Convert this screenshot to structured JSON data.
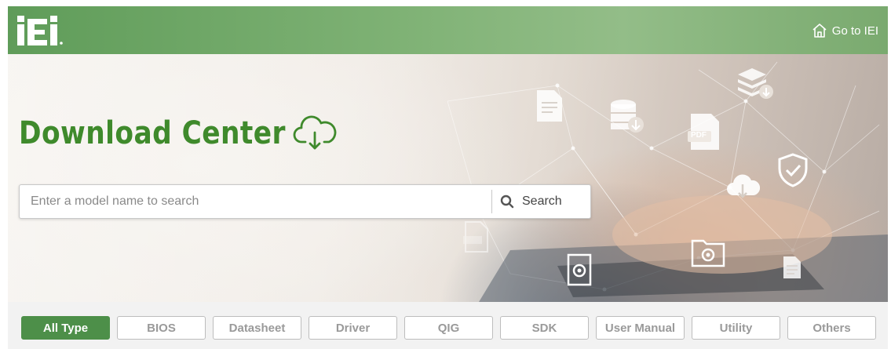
{
  "header": {
    "logo_text": "iEi",
    "goto_label": "Go to IEI",
    "home_icon": "home-icon"
  },
  "hero": {
    "title": "Download Center",
    "title_color": "#3f8a2c",
    "title_icon": "cloud-download-icon",
    "search": {
      "placeholder": "Enter a model name to search",
      "value": "",
      "button_label": "Search",
      "button_icon": "search-icon"
    },
    "decor_icons": [
      "document-icon",
      "database-download-icon",
      "stack-download-icon",
      "pdf-file-icon",
      "shield-check-icon",
      "cloud-download-icon",
      "pdf-file-icon",
      "gear-document-icon",
      "folder-gear-icon",
      "document-icon"
    ],
    "decor_labels": {
      "pdf": "PDF"
    }
  },
  "filters": {
    "active_color": "#4d8f49",
    "items": [
      {
        "label": "All Type",
        "active": true
      },
      {
        "label": "BIOS",
        "active": false
      },
      {
        "label": "Datasheet",
        "active": false
      },
      {
        "label": "Driver",
        "active": false
      },
      {
        "label": "QIG",
        "active": false
      },
      {
        "label": "SDK",
        "active": false
      },
      {
        "label": "User Manual",
        "active": false
      },
      {
        "label": "Utility",
        "active": false
      },
      {
        "label": "Others",
        "active": false
      }
    ]
  }
}
